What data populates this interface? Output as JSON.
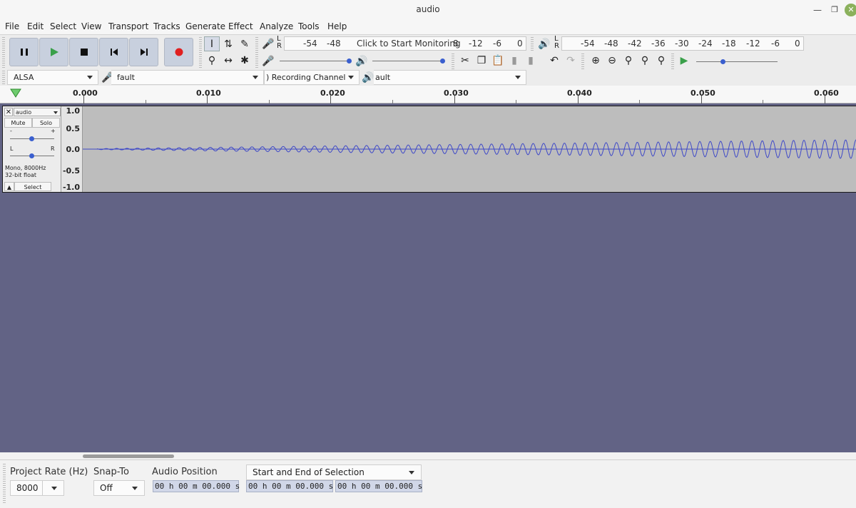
{
  "window": {
    "title": "audio"
  },
  "menu": [
    "File",
    "Edit",
    "Select",
    "View",
    "Transport",
    "Tracks",
    "Generate",
    "Effect",
    "Analyze",
    "Tools",
    "Help"
  ],
  "meters": {
    "record_scale": [
      "-54",
      "-48",
      "-12",
      "-6",
      "0"
    ],
    "record_prompt": "Click to Start Monitoring",
    "record_prompt_prefix": "8",
    "playback_scale": [
      "-54",
      "-48",
      "-42",
      "-36",
      "-30",
      "-24",
      "-18",
      "-12",
      "-6",
      "0"
    ],
    "lr_label": "L\nR"
  },
  "device": {
    "host": "ALSA",
    "recording_device": "fault",
    "recording_channels": ") Recording Channel",
    "playback_device": "ault"
  },
  "ruler": {
    "ticks": [
      "0.000",
      "0.010",
      "0.020",
      "0.030",
      "0.040",
      "0.050",
      "0.060"
    ]
  },
  "track": {
    "name": "audio",
    "mute_label": "Mute",
    "solo_label": "Solo",
    "gain_minus": "-",
    "gain_plus": "+",
    "pan_left": "L",
    "pan_right": "R",
    "info_line1": "Mono, 8000Hz",
    "info_line2": "32-bit float",
    "select_label": "Select",
    "scale": [
      "1.0",
      "0.5",
      "0.0",
      "-0.5",
      "-1.0"
    ]
  },
  "status": {
    "project_rate_label": "Project Rate (Hz)",
    "project_rate_value": "8000",
    "snap_label": "Snap-To",
    "snap_value": "Off",
    "audio_position_label": "Audio Position",
    "selection_mode": "Start and End of Selection",
    "audio_position": "00 h 00 m 00.000 s",
    "selection_start": "00 h 00 m 00.000 s",
    "selection_end": "00 h 00 m 00.000 s"
  },
  "colors": {
    "accent": "#3a5fcf",
    "record": "#e02020",
    "play": "#3aa04a",
    "background_canvas": "#626385"
  }
}
